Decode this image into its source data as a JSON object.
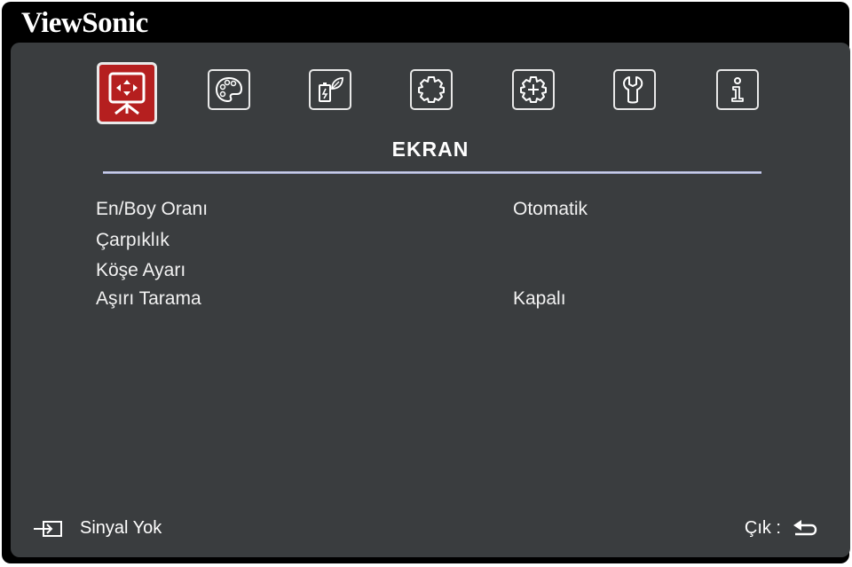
{
  "brand": "ViewSonic",
  "tabs": [
    {
      "icon": "display-icon",
      "active": true
    },
    {
      "icon": "palette-icon",
      "active": false
    },
    {
      "icon": "power-leaf-icon",
      "active": false
    },
    {
      "icon": "gear-icon",
      "active": false
    },
    {
      "icon": "advanced-gear-icon",
      "active": false
    },
    {
      "icon": "wrench-icon",
      "active": false
    },
    {
      "icon": "info-icon",
      "active": false
    }
  ],
  "section_title": "EKRAN",
  "menu": [
    {
      "label": "En/Boy Oranı",
      "value": "Otomatik"
    },
    {
      "label": "Çarpıklık",
      "value": ""
    },
    {
      "label": "Köşe Ayarı",
      "value": ""
    },
    {
      "label": "Aşırı Tarama",
      "value": "Kapalı"
    }
  ],
  "footer": {
    "signal_text": "Sinyal Yok",
    "exit_text": "Çık :"
  },
  "colors": {
    "active_tab": "#b51f1f",
    "panel": "#3a3d3f",
    "frame": "#000000"
  }
}
